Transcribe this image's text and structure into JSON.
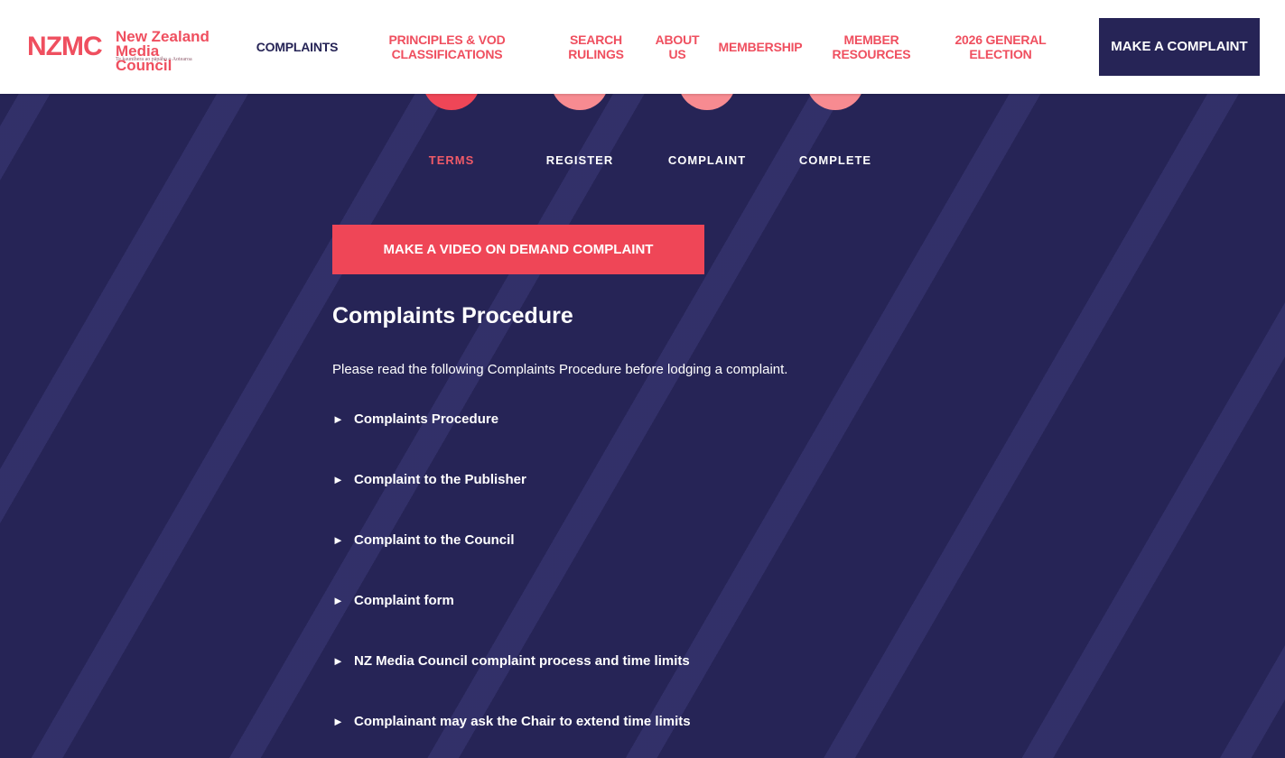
{
  "logo": {
    "mark": "NZMC",
    "line1": "New Zealand",
    "line2": "Media Council",
    "tagline": "Te kaunihera ao pāpāho o Aotearoa"
  },
  "nav": {
    "items": [
      {
        "label": "COMPLAINTS",
        "active": true
      },
      {
        "label": "PRINCIPLES & VOD CLASSIFICATIONS"
      },
      {
        "label": "SEARCH RULINGS"
      },
      {
        "label": "ABOUT US"
      },
      {
        "label": "MEMBERSHIP"
      },
      {
        "label": "MEMBER RESOURCES"
      },
      {
        "label": "2026 GENERAL ELECTION"
      }
    ],
    "cta": "MAKE A COMPLAINT"
  },
  "steps": [
    {
      "label": "TERMS",
      "active": true
    },
    {
      "label": "REGISTER"
    },
    {
      "label": "COMPLAINT"
    },
    {
      "label": "COMPLETE"
    }
  ],
  "main": {
    "vod_button": "MAKE A VIDEO ON DEMAND COMPLAINT",
    "heading": "Complaints Procedure",
    "intro": "Please read the following Complaints Procedure before lodging a complaint.",
    "accordion_arrow": "►",
    "accordion": [
      "Complaints Procedure",
      "Complaint to the Publisher",
      "Complaint to the Council",
      "Complaint form",
      "NZ Media Council complaint process and time limits",
      "Complainant may ask the Chair to extend time limits"
    ]
  },
  "colors": {
    "navy": "#262456",
    "coral": "#ef4657",
    "coral_light": "#f78b91"
  }
}
